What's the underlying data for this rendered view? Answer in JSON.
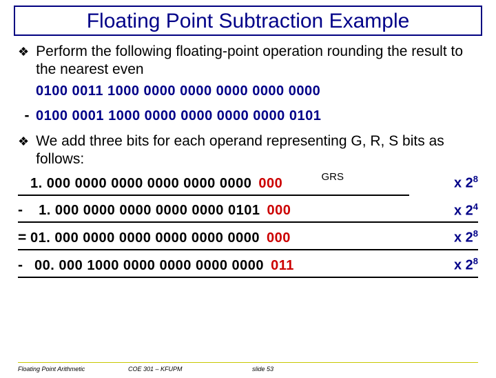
{
  "title": "Floating Point Subtraction Example",
  "bullets": {
    "b1": "Perform the following floating-point operation rounding the result to the nearest even",
    "b2": "We add three bits for each operand representing G, R, S bits as follows:"
  },
  "lines": {
    "l1": "0100 0011 1000 0000 0000 0000 0000 0000",
    "l2_op": "-",
    "l2": "0100 0001 1000 0000 0000 0000 0000 0101"
  },
  "grs_label": "GRS",
  "calc": [
    {
      "op": "",
      "mantissa": "1. 000 0000 0000 0000 0000 0000",
      "grs": "000",
      "mult": "x 2",
      "exp": "8"
    },
    {
      "op": "-",
      "mantissa": "  1. 000 0000 0000 0000 0000 0101",
      "grs": "000",
      "mult": "x 2",
      "exp": "4"
    },
    {
      "op": "=",
      "mantissa": "01. 000 0000 0000 0000 0000 0000",
      "grs": "000",
      "mult": "x 2",
      "exp": "8"
    },
    {
      "op": "-",
      "mantissa": " 00. 000 1000 0000 0000 0000 0000",
      "grs": "011",
      "mult": "x 2",
      "exp": "8"
    }
  ],
  "footer": {
    "f1": "Floating Point Arithmetic",
    "f2": "COE 301 – KFUPM",
    "f3": "slide 53"
  }
}
